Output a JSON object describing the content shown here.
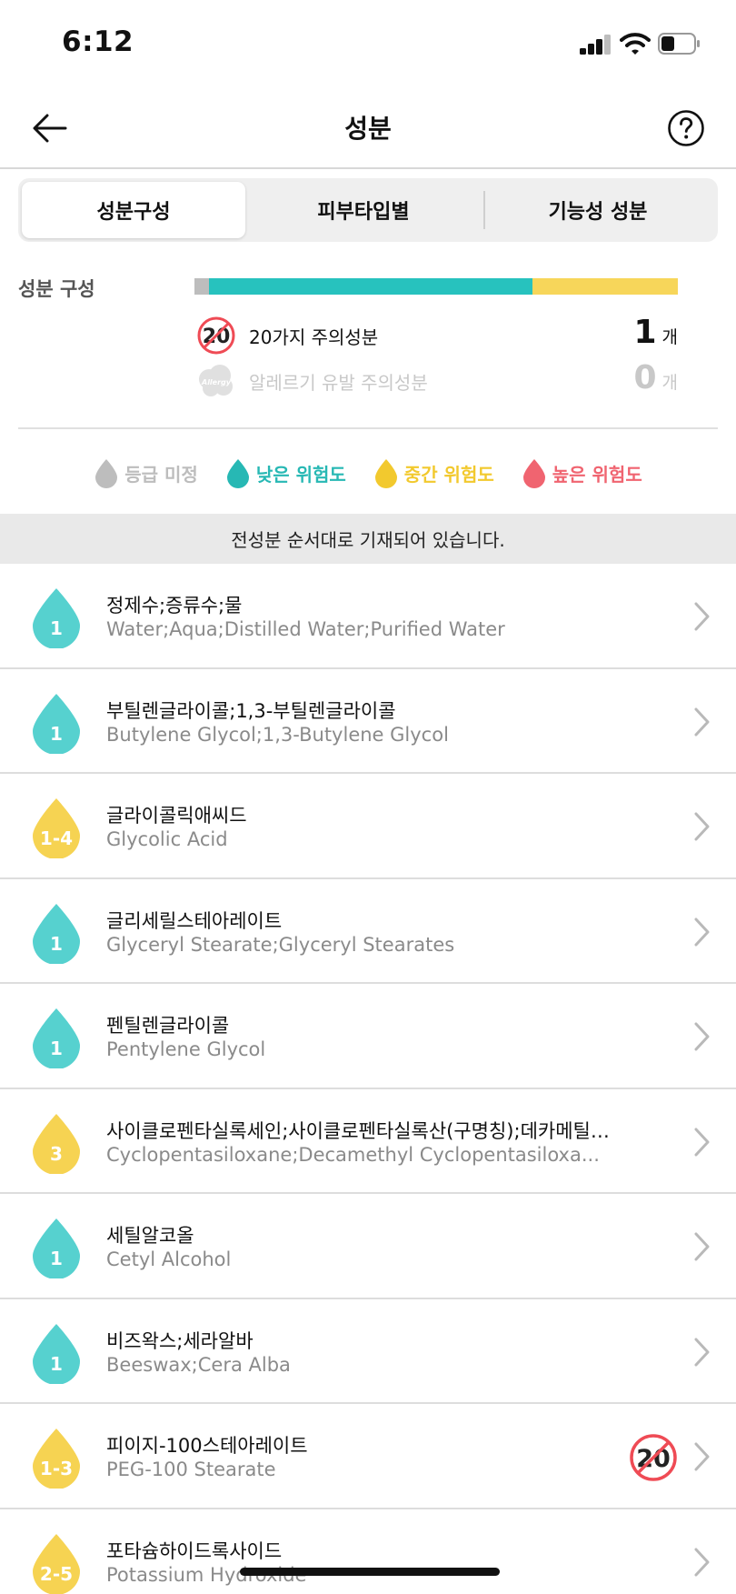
{
  "status": {
    "time": "6:12"
  },
  "header": {
    "title": "성분"
  },
  "tabs": [
    {
      "label": "성분구성",
      "selected": true
    },
    {
      "label": "피부타입별",
      "selected": false
    },
    {
      "label": "기능성 성분",
      "selected": false
    }
  ],
  "composition": {
    "label": "성분 구성",
    "bar": [
      {
        "level": "unrated",
        "fraction": 0.03,
        "color": "#bdbdbd"
      },
      {
        "level": "low",
        "fraction": 0.67,
        "color": "#27c2be"
      },
      {
        "level": "medium",
        "fraction": 0.3,
        "color": "#f7d65a"
      }
    ],
    "twenty_icon_text": "20",
    "twenty_label": "20가지 주의성분",
    "twenty_count": "1",
    "allergy_icon_text": "Allergy",
    "allergy_label": "알레르기 유발 주의성분",
    "allergy_count": "0",
    "unit": "개"
  },
  "legend": [
    {
      "label": "등급 미정",
      "color": "#bdbdbd"
    },
    {
      "label": "낮은 위험도",
      "color": "#27b8b4"
    },
    {
      "label": "중간 위험도",
      "color": "#f2c92e"
    },
    {
      "label": "높은 위험도",
      "color": "#f06470"
    }
  ],
  "notice": "전성분 순서대로 기재되어 있습니다.",
  "ingredients": [
    {
      "grade": "1",
      "level": "low",
      "ko": "정제수;증류수;물",
      "en": "Water;Aqua;Distilled Water;Purified Water",
      "twenty": false
    },
    {
      "grade": "1",
      "level": "low",
      "ko": "부틸렌글라이콜;1,3-부틸렌글라이콜",
      "en": "Butylene Glycol;1,3-Butylene Glycol",
      "twenty": false
    },
    {
      "grade": "1-4",
      "level": "medium",
      "ko": "글라이콜릭애씨드",
      "en": "Glycolic Acid",
      "twenty": false
    },
    {
      "grade": "1",
      "level": "low",
      "ko": "글리세릴스테아레이트",
      "en": "Glyceryl Stearate;Glyceryl Stearates",
      "twenty": false
    },
    {
      "grade": "1",
      "level": "low",
      "ko": "펜틸렌글라이콜",
      "en": "Pentylene Glycol",
      "twenty": false
    },
    {
      "grade": "3",
      "level": "medium",
      "ko": "사이클로펜타실록세인;사이클로펜타실록산(구명칭);데카메틸…",
      "en": "Cyclopentasiloxane;Decamethyl Cyclopentasiloxa...",
      "twenty": false
    },
    {
      "grade": "1",
      "level": "low",
      "ko": "세틸알코올",
      "en": "Cetyl Alcohol",
      "twenty": false
    },
    {
      "grade": "1",
      "level": "low",
      "ko": "비즈왁스;세라알바",
      "en": "Beeswax;Cera Alba",
      "twenty": false
    },
    {
      "grade": "1-3",
      "level": "medium",
      "ko": "피이지-100스테아레이트",
      "en": "PEG-100 Stearate",
      "twenty": true
    },
    {
      "grade": "2-5",
      "level": "medium",
      "ko": "포타슘하이드록사이드",
      "en": "Potassium Hydroxide",
      "twenty": false
    }
  ],
  "colors": {
    "low": "#56d1cf",
    "medium": "#f6d352",
    "twenty_red": "#ef4b55"
  }
}
